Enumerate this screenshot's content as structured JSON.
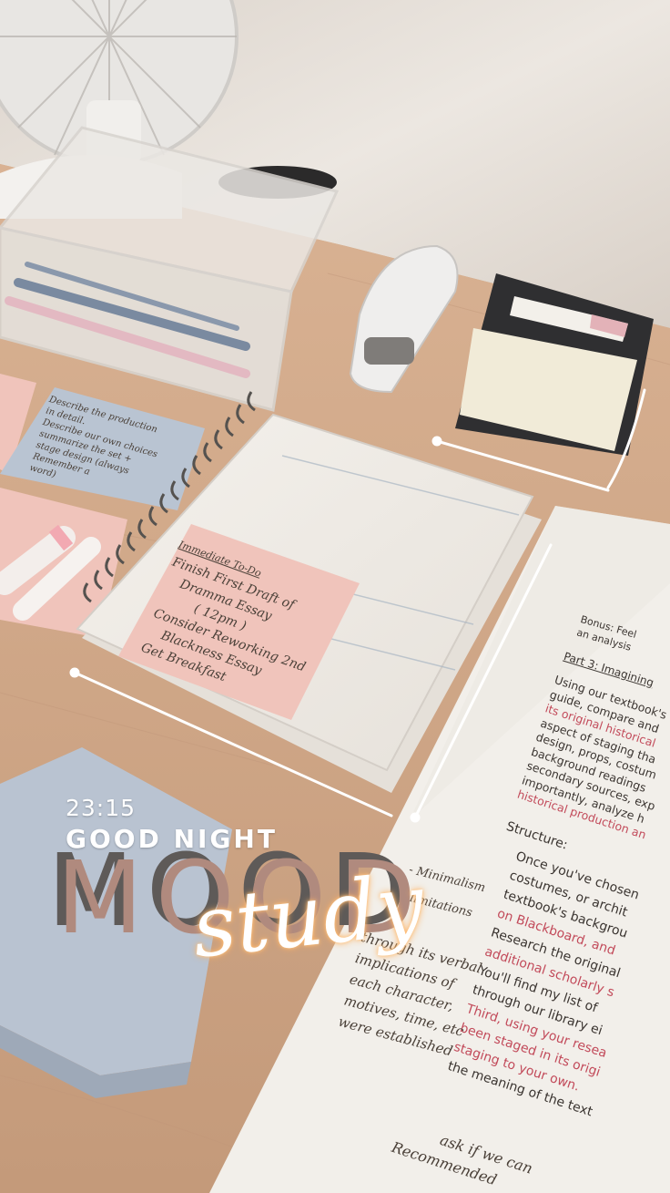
{
  "overlay": {
    "time": "23:15",
    "greeting": "GOOD NIGHT",
    "mood": "MOOD",
    "script": "study"
  },
  "notebook": {
    "sticky_heading": "Immediate To-Do",
    "tasks": [
      "Finish First Draft of",
      "Dramma Essay",
      "( 12pm )",
      "Consider Reworking 2nd",
      "Blackness Essay",
      "Get Breakfast"
    ]
  },
  "handout": {
    "part_heading": "Part 3: Imagining",
    "bonus": "Bonus: Feel",
    "bonus2": "an analysis",
    "paragraph": [
      "Using our textbook's",
      "guide, compare and",
      "its original historical",
      "aspect of staging tha",
      "design, props, costum",
      "background readings",
      "secondary sources, exp",
      "importantly, analyze h",
      "historical production an"
    ],
    "structure_label": "Structure:",
    "bullets": [
      "Once you've chosen",
      "costumes, or archit",
      "textbook's backgrou",
      "on Blackboard, and",
      "Research the original",
      "additional scholarly s",
      "You'll find my list of",
      "through our library ei",
      "Third, using your resea",
      "been staged in its origi",
      "staging to your own.",
      "the meaning of the text"
    ],
    "margin_notes": [
      "- Minimalism",
      "- limitations",
      "through its verbal",
      "implications of",
      "each character,",
      "motives, time, etc",
      "were established"
    ],
    "bottom_notes": [
      "ask if we can",
      "Recommended"
    ]
  },
  "sticky_blue_notes": [
    "Describe the production",
    "in detail.",
    "Describe our own choices",
    "summarize the set +",
    "stage design (always",
    "Remember a",
    "word)"
  ],
  "colors": {
    "desk": "#cfa98a",
    "wall": "#e9e3dd",
    "pink_note": "#f0c4bb",
    "blue_note": "#b9c4d2",
    "paper": "#f2efea",
    "highlight_pink": "#c24a5a"
  }
}
